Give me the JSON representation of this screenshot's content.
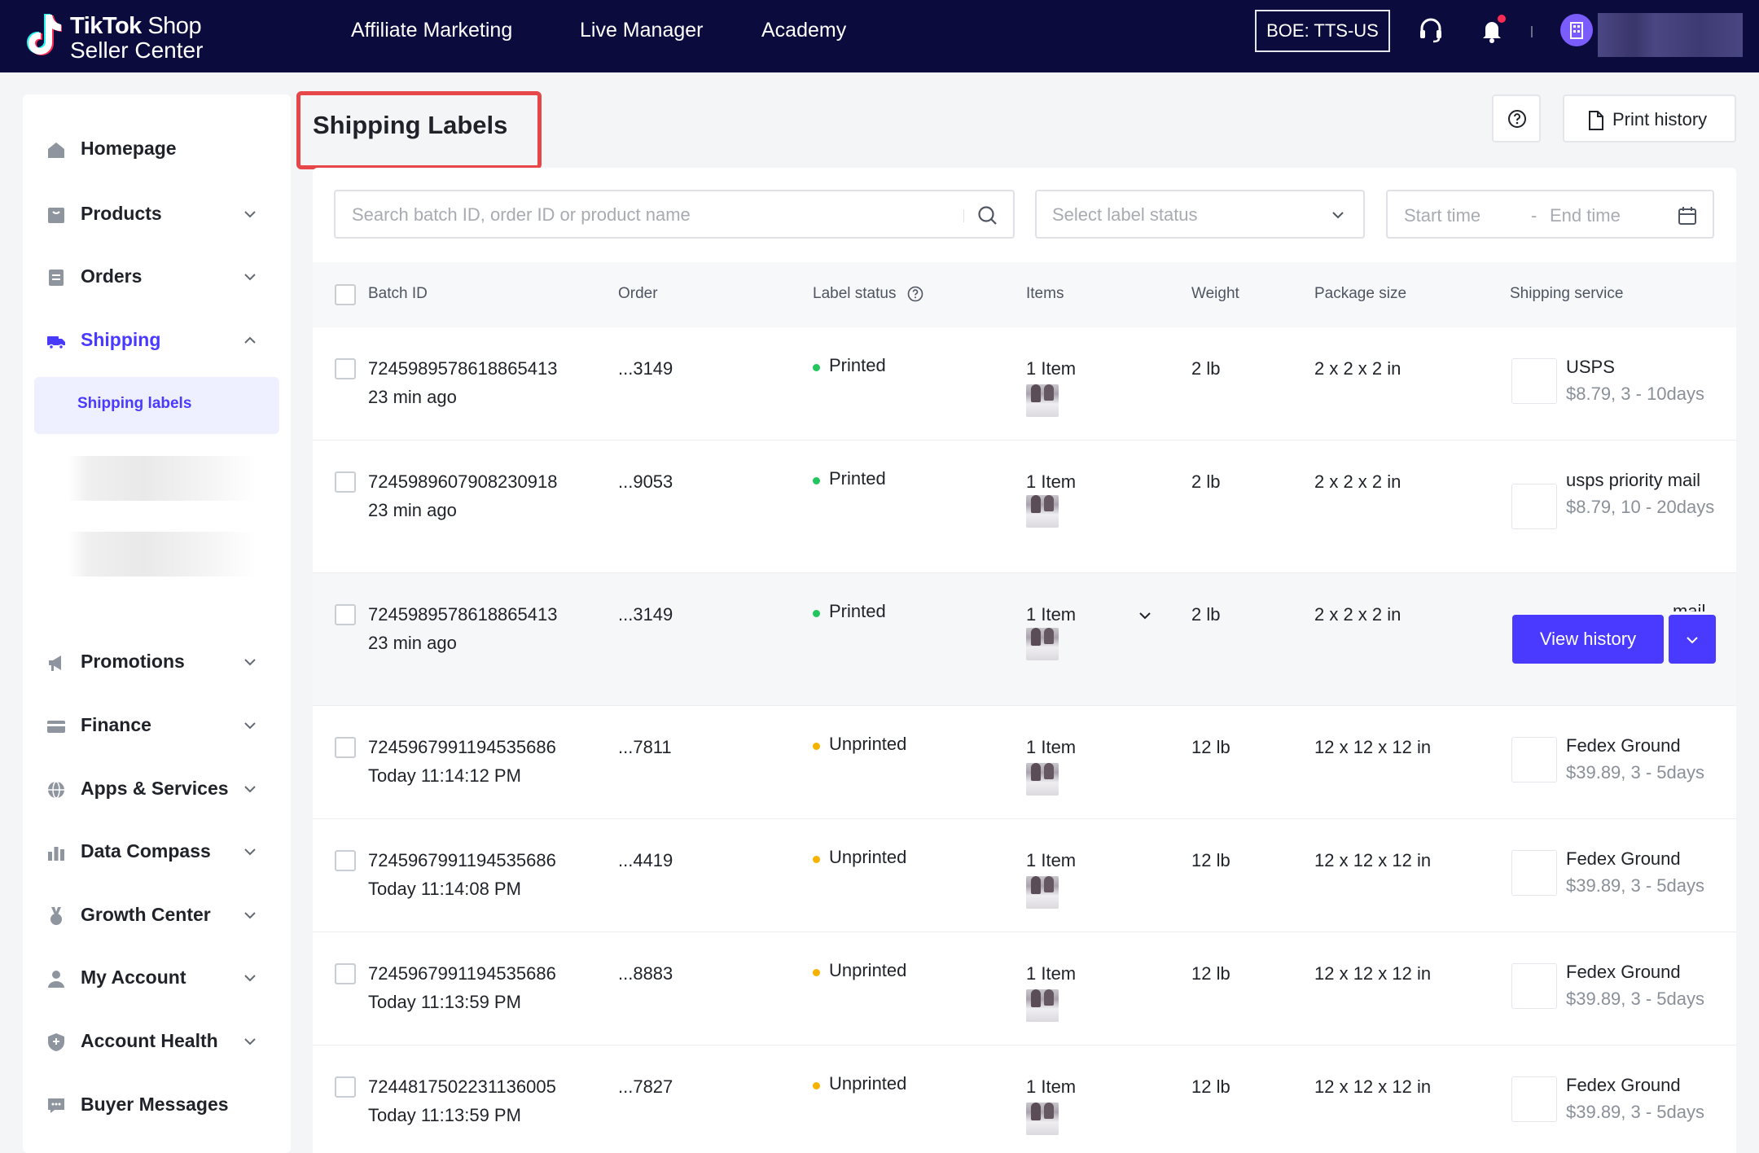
{
  "brand": {
    "name_bold": "TikTok",
    "name_rest": " Shop",
    "subtitle": "Seller Center"
  },
  "topnav": [
    "Affiliate Marketing",
    "Live Manager",
    "Academy"
  ],
  "env_badge": "BOE: TTS-US",
  "topbar_icons": [
    "headset-icon",
    "bell-icon",
    "shop-avatar-icon"
  ],
  "sidebar": {
    "items": [
      {
        "label": "Homepage",
        "icon": "home-icon"
      },
      {
        "label": "Products",
        "icon": "bag-icon"
      },
      {
        "label": "Orders",
        "icon": "clipboard-icon"
      },
      {
        "label": "Shipping",
        "icon": "truck-icon"
      },
      {
        "label": "Promotions",
        "icon": "megaphone-icon"
      },
      {
        "label": "Finance",
        "icon": "card-icon"
      },
      {
        "label": "Apps & Services",
        "icon": "globe-icon"
      },
      {
        "label": "Data Compass",
        "icon": "bar-chart-icon"
      },
      {
        "label": "Growth Center",
        "icon": "medal-icon"
      },
      {
        "label": "My Account",
        "icon": "user-icon"
      },
      {
        "label": "Account Health",
        "icon": "shield-icon"
      },
      {
        "label": "Buyer Messages",
        "icon": "chat-icon"
      }
    ],
    "active_sub": "Shipping labels"
  },
  "page": {
    "title": "Shipping Labels",
    "print_history": "Print history"
  },
  "filters": {
    "search_placeholder": "Search batch ID, order ID or product name",
    "status_placeholder": "Select label status",
    "start_time": "Start time",
    "dash": "-",
    "end_time": "End time"
  },
  "table": {
    "headers": [
      "Batch ID",
      "Order",
      "Label status",
      "Items",
      "Weight",
      "Package size",
      "Shipping service"
    ],
    "rows": [
      {
        "batch": "7245989578618865413",
        "time": "23 min ago",
        "order": "...3149",
        "status": "Printed",
        "items": "1 Item",
        "weight": "2 lb",
        "size": "2 x 2 x 2 in",
        "svc_name": "USPS",
        "svc_price": "$8.79, 3 - 10days"
      },
      {
        "batch": "7245989607908230918",
        "time": "23 min ago",
        "order": "...9053",
        "status": "Printed",
        "items": "1 Item",
        "weight": "2 lb",
        "size": "2 x 2 x 2 in",
        "svc_name": "usps priority mail",
        "svc_price": "$8.79, 10 - 20days"
      },
      {
        "batch": "7245989578618865413",
        "time": "23 min ago",
        "order": "...3149",
        "status": "Printed",
        "items": "1 Item",
        "weight": "2 lb",
        "size": "2 x 2 x 2 in",
        "svc_name": "mail",
        "svc_price": ""
      },
      {
        "batch": "7245967991194535686",
        "time": "Today 11:14:12 PM",
        "order": "...7811",
        "status": "Unprinted",
        "items": "1 Item",
        "weight": "12 lb",
        "size": "12 x 12 x 12 in",
        "svc_name": "Fedex Ground",
        "svc_price": "$39.89, 3 - 5days"
      },
      {
        "batch": "7245967991194535686",
        "time": "Today 11:14:08 PM",
        "order": "...4419",
        "status": "Unprinted",
        "items": "1 Item",
        "weight": "12 lb",
        "size": "12 x 12 x 12 in",
        "svc_name": "Fedex Ground",
        "svc_price": "$39.89, 3 - 5days"
      },
      {
        "batch": "7245967991194535686",
        "time": "Today 11:13:59 PM",
        "order": "...8883",
        "status": "Unprinted",
        "items": "1 Item",
        "weight": "12 lb",
        "size": "12 x 12 x 12 in",
        "svc_name": "Fedex Ground",
        "svc_price": "$39.89, 3 - 5days"
      },
      {
        "batch": "7244817502231136005",
        "time": "Today 11:13:59 PM",
        "order": "...7827",
        "status": "Unprinted",
        "items": "1 Item",
        "weight": "12 lb",
        "size": "12 x 12 x 12 in",
        "svc_name": "Fedex Ground",
        "svc_price": "$39.89, 3 - 5days"
      }
    ],
    "view_history": "View history"
  },
  "colors": {
    "accent": "#4a3aff",
    "printed": "#22c55e",
    "unprinted": "#f5b300",
    "topbar": "#0c0b3d",
    "highlight_border": "#e8474a"
  }
}
